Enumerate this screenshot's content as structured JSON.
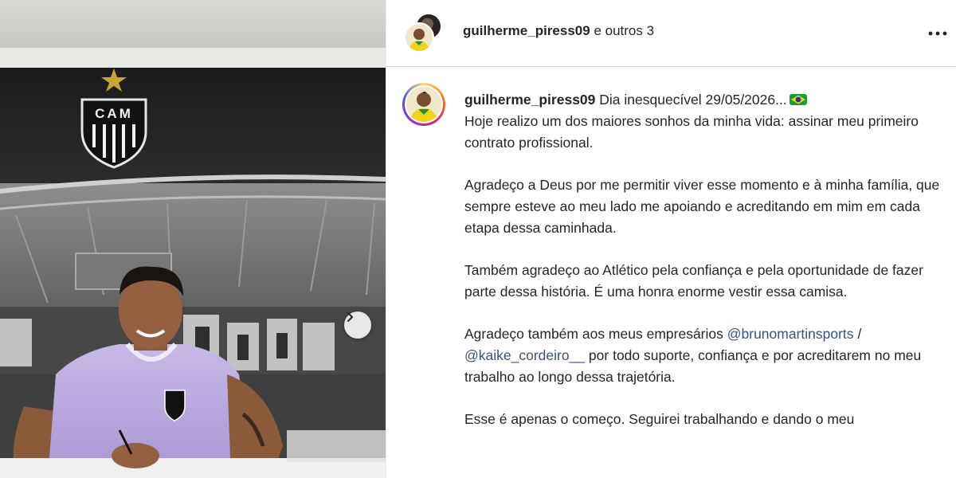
{
  "photo": {
    "club_badge_text": "CAM",
    "next_icon": "chevron-right-icon"
  },
  "header": {
    "username": "guilherme_piress09",
    "others_text": "e outros 3",
    "more_icon": "ellipsis-icon"
  },
  "caption": {
    "username": "guilherme_piress09",
    "first_line": "Dia inesquecível 29/05/2026...",
    "emoji_icon": "brazil-flag-emoji",
    "p1": "Hoje realizo um dos maiores sonhos da minha vida: assinar meu primeiro contrato profissional.",
    "p2": "Agradeço a Deus por me permitir viver esse momento e à minha família, que sempre esteve ao meu lado me apoiando e acreditando em mim em cada etapa dessa caminhada.",
    "p3": "Também agradeço ao Atlético pela confiança e pela oportunidade de fazer parte dessa história. É uma honra enorme vestir essa camisa.",
    "p4_before": "Agradeço também aos meus empresários",
    "mention1": "@brunomartinsports",
    "p4_sep": "/",
    "mention2": "@kaike_cordeiro__",
    "p4_after": "por todo suporte, confiança e por acreditarem no meu trabalho ao longo dessa trajetória.",
    "p5": "Esse é apenas o começo. Seguirei trabalhando e dando o meu"
  },
  "colors": {
    "mention": "#385185",
    "text": "#262626",
    "divider": "#dbdbdb"
  }
}
